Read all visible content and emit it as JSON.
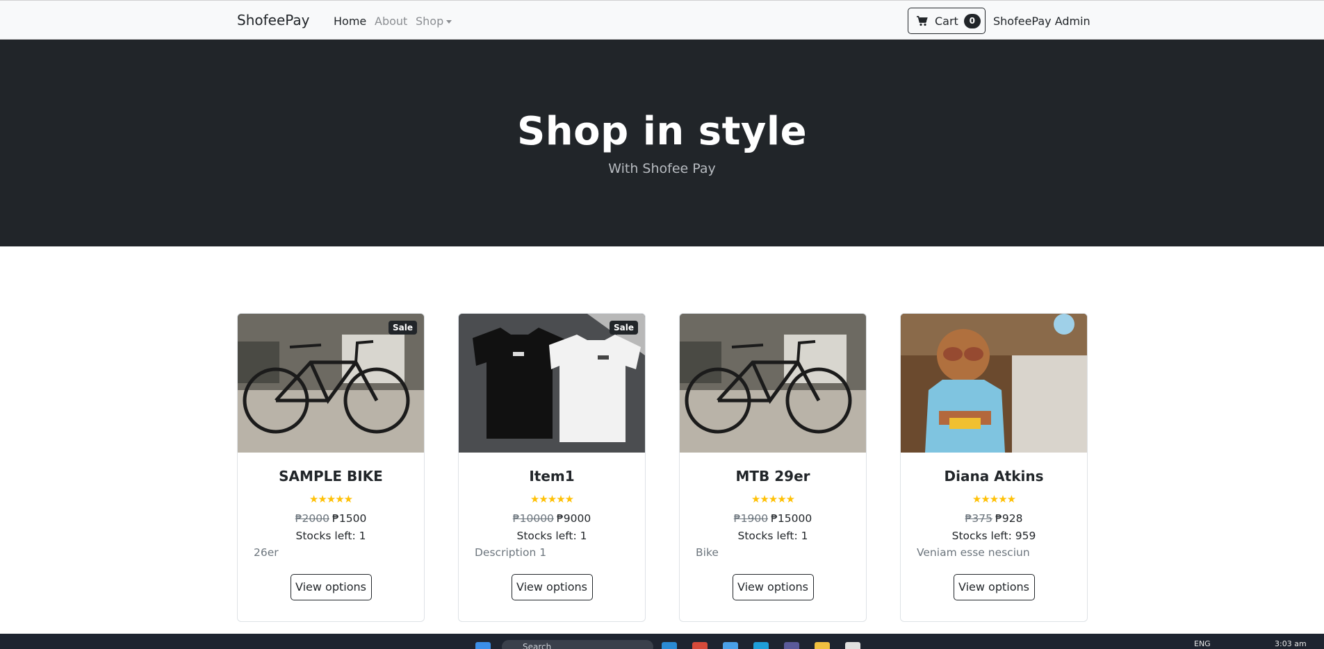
{
  "navbar": {
    "brand": "ShofeePay",
    "links": [
      "Home",
      "About",
      "Shop"
    ],
    "cart_label": "Cart",
    "cart_count": "0",
    "user": "ShofeePay Admin"
  },
  "hero": {
    "title": "Shop in style",
    "subtitle": "With Shofee Pay"
  },
  "products": [
    {
      "name": "SAMPLE BIKE",
      "sale_badge": "Sale",
      "old_price": "₱2000",
      "price": "₱1500",
      "stock": "Stocks left: 1",
      "description": "26er",
      "button": "View options",
      "rating": 5,
      "image": "bicycle-photo"
    },
    {
      "name": "Item1",
      "sale_badge": "Sale",
      "old_price": "₱10000",
      "price": "₱9000",
      "stock": "Stocks left: 1",
      "description": "Description 1",
      "button": "View options",
      "rating": 5,
      "image": "tshirts-photo"
    },
    {
      "name": "MTB 29er",
      "sale_badge": "",
      "old_price": "₱1900",
      "price": "₱15000",
      "stock": "Stocks left: 1",
      "description": "Bike",
      "button": "View options",
      "rating": 5,
      "image": "bicycle-photo"
    },
    {
      "name": "Diana Atkins",
      "sale_badge": "",
      "old_price": "₱375",
      "price": "₱928",
      "stock": "Stocks left: 959",
      "description": "Veniam esse nesciun",
      "button": "View options",
      "rating": 5,
      "image": "child-photo"
    }
  ],
  "taskbar": {
    "search_placeholder": "Search",
    "language": "ENG",
    "time": "3:03 am"
  },
  "colors": {
    "hero_bg": "#212529",
    "navbar_bg": "#f8f9fa",
    "star": "#ffc107"
  }
}
